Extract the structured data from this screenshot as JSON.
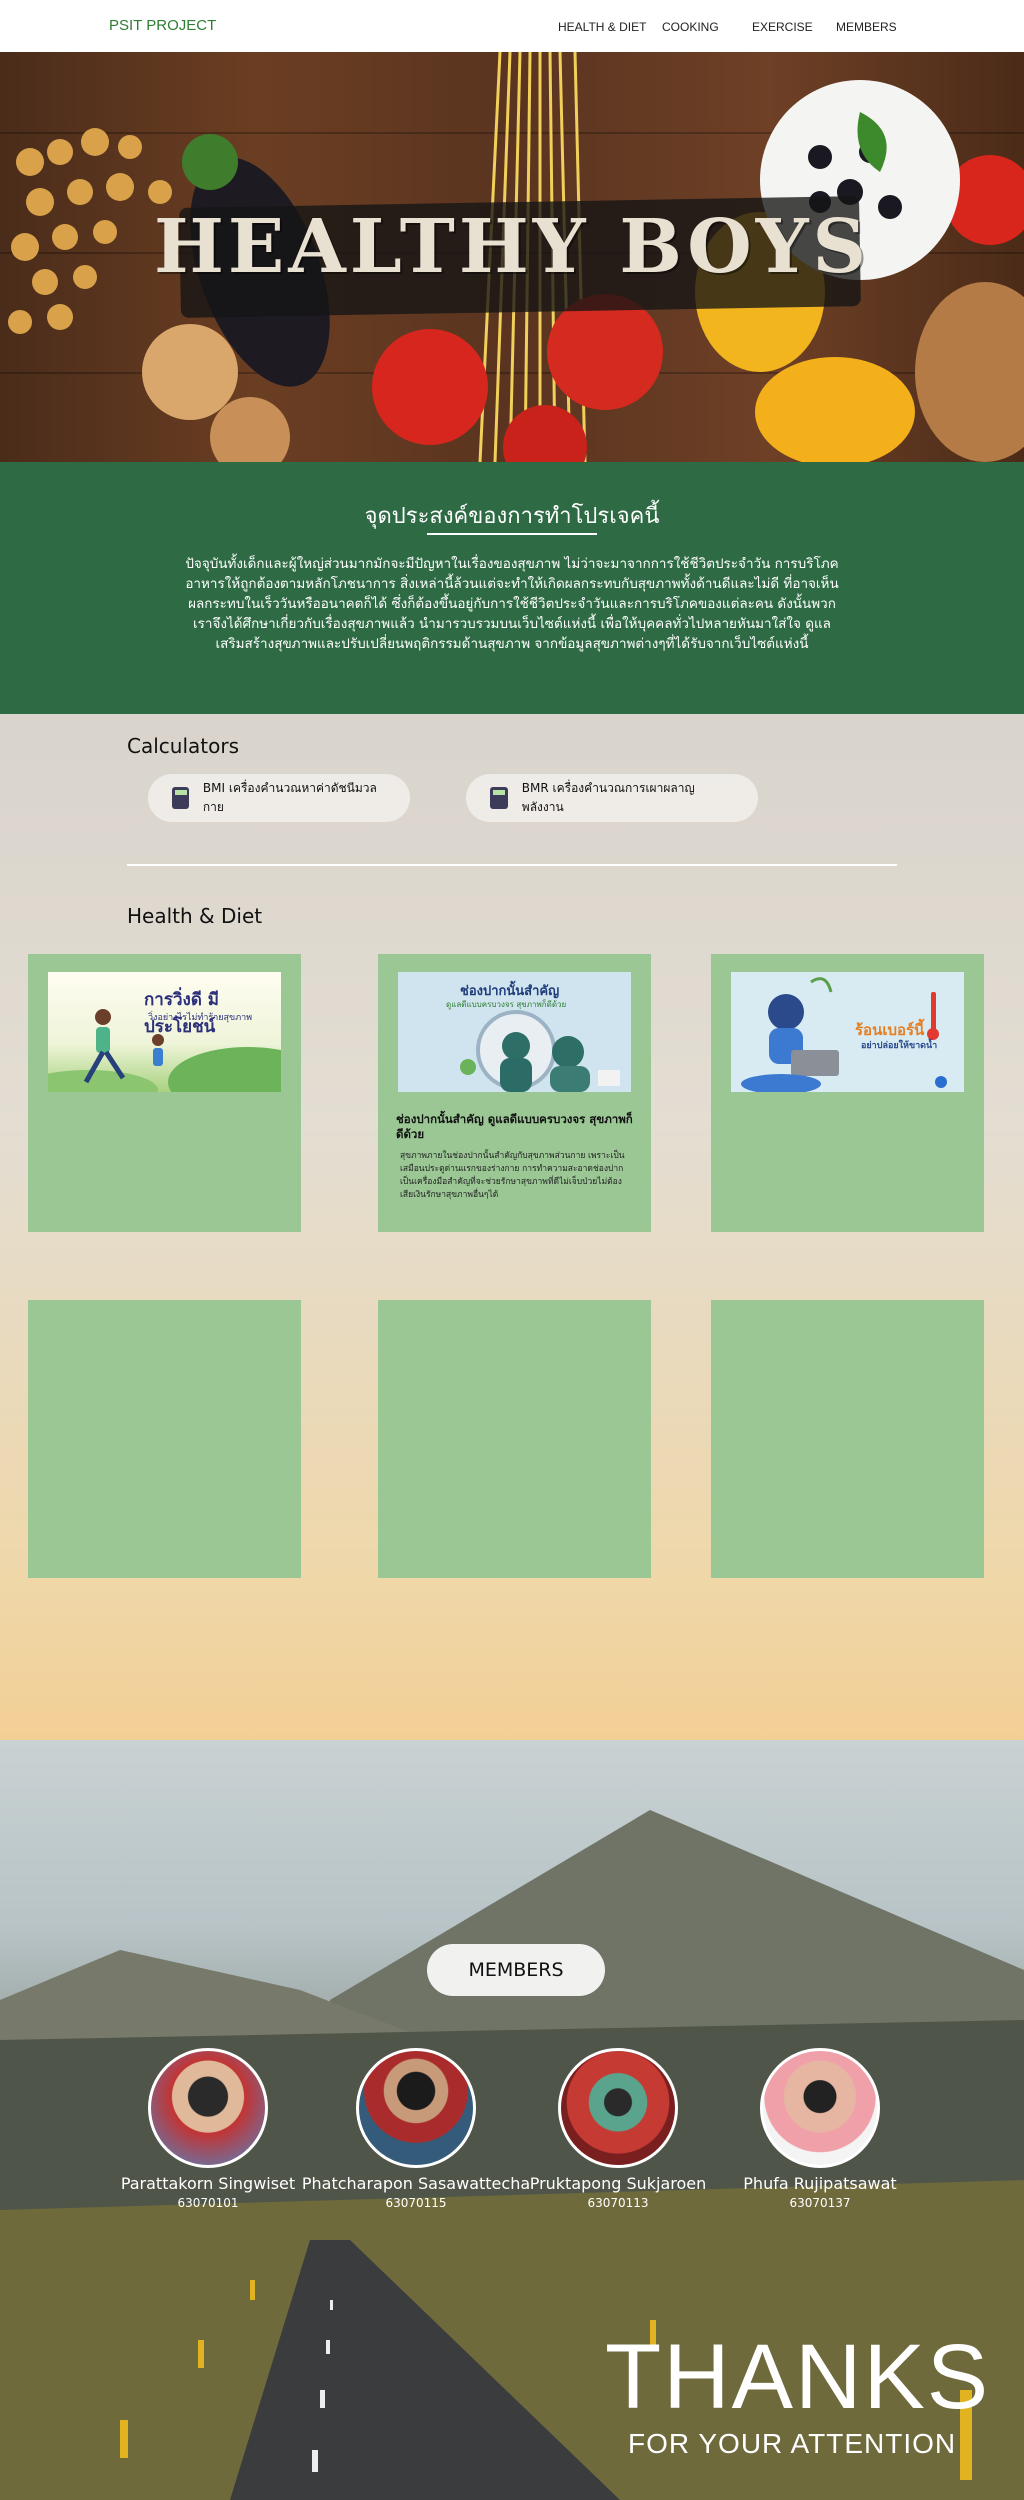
{
  "nav": {
    "brand": "PSIT PROJECT",
    "links": [
      "HEALTH & DIET",
      "COOKING",
      "EXERCISE",
      "MEMBERS"
    ]
  },
  "hero": {
    "title": "HEALTHY BOYS"
  },
  "purpose": {
    "heading": "จุดประสงค์ของการทำโปรเจคนี้",
    "paragraph": "ปัจจุบันทั้งเด็กและผู้ใหญ่ส่วนมากมักจะมีปัญหาในเรื่องของสุขภาพ ไม่ว่าจะมาจากการใช้ชีวิตประจำวัน การบริโภคอาหารให้ถูกต้องตามหลักโภชนาการ สิ่งเหล่านี้ล้วนแต่จะทำให้เกิดผลกระทบกับสุขภาพทั้งด้านดีและไม่ดี ที่อาจเห็นผลกระทบในเร็ววันหรืออนาคตก็ได้ ซึ่งก็ต้องขึ้นอยู่กับการใช้ชีวิตประจำวันและการบริโภคของแต่ละคน ดังนั้นพวกเราจึงได้ศึกษาเกี่ยวกับเรื่องสุขภาพแล้ว นำมารวบรวมบนเว็บไซต์แห่งนี้ เพื่อให้บุคคลทั่วไปหลายหันมาใส่ใจ ดูแลเสริมสร้างสุขภาพและปรับเปลี่ยนพฤติกรรมด้านสุขภาพ จากข้อมูลสุขภาพต่างๆที่ได้รับจากเว็บไซต์แห่งนี้"
  },
  "calculators": {
    "title": "Calculators",
    "items": [
      {
        "label": "BMI เครื่องคำนวณหาค่าดัชนีมวลกาย",
        "icon": "calculator-icon"
      },
      {
        "label": "BMR เครื่องคำนวณการเผาผลาญพลังงาน",
        "icon": "calculator-icon"
      }
    ]
  },
  "health": {
    "title": "Health & Diet",
    "cards": [
      {
        "thumb_title": "การวิ่งดี มีประโยชน์",
        "thumb_sub": "วิ่งอย่างไรไม่ทำร้ายสุขภาพ",
        "title": "",
        "body": ""
      },
      {
        "thumb_title": "ช่องปากนั้นสำคัญ",
        "thumb_sub": "ดูแลดีแบบครบวงจร สุขภาพก็ดีด้วย",
        "title": "ช่องปากนั้นสำคัญ ดูแลดีแบบครบวงจร สุขภาพก็ดีด้วย",
        "body": "สุขภาพภายในช่องปากนั้นสำคัญกับสุขภาพส่วนกาย เพราะเป็นเสมือนประตูด่านแรกของร่างกาย การทำความสะอาดช่องปากเป็นเครื่องมือสำคัญที่จะช่วยรักษาสุขภาพที่ดีไม่เจ็บป่วยไม่ต้องเสียเงินรักษาสุขภาพอื่นๆได้"
      },
      {
        "thumb_title": "ร้อนเบอร์นี้",
        "thumb_sub": "อย่าปล่อยให้ขาดน้ำ",
        "title": "",
        "body": ""
      }
    ]
  },
  "members": {
    "title": "MEMBERS",
    "people": [
      {
        "name": "Parattakorn Singwiset",
        "id": "63070101"
      },
      {
        "name": "Phatcharapon Sasawattecha",
        "id": "63070115"
      },
      {
        "name": "Pruktapong Sukjaroen",
        "id": "63070113"
      },
      {
        "name": "Phufa Rujipatsawat",
        "id": "63070137"
      }
    ],
    "thanks": "THANKS",
    "attention": "FOR YOUR ATTENTION"
  }
}
